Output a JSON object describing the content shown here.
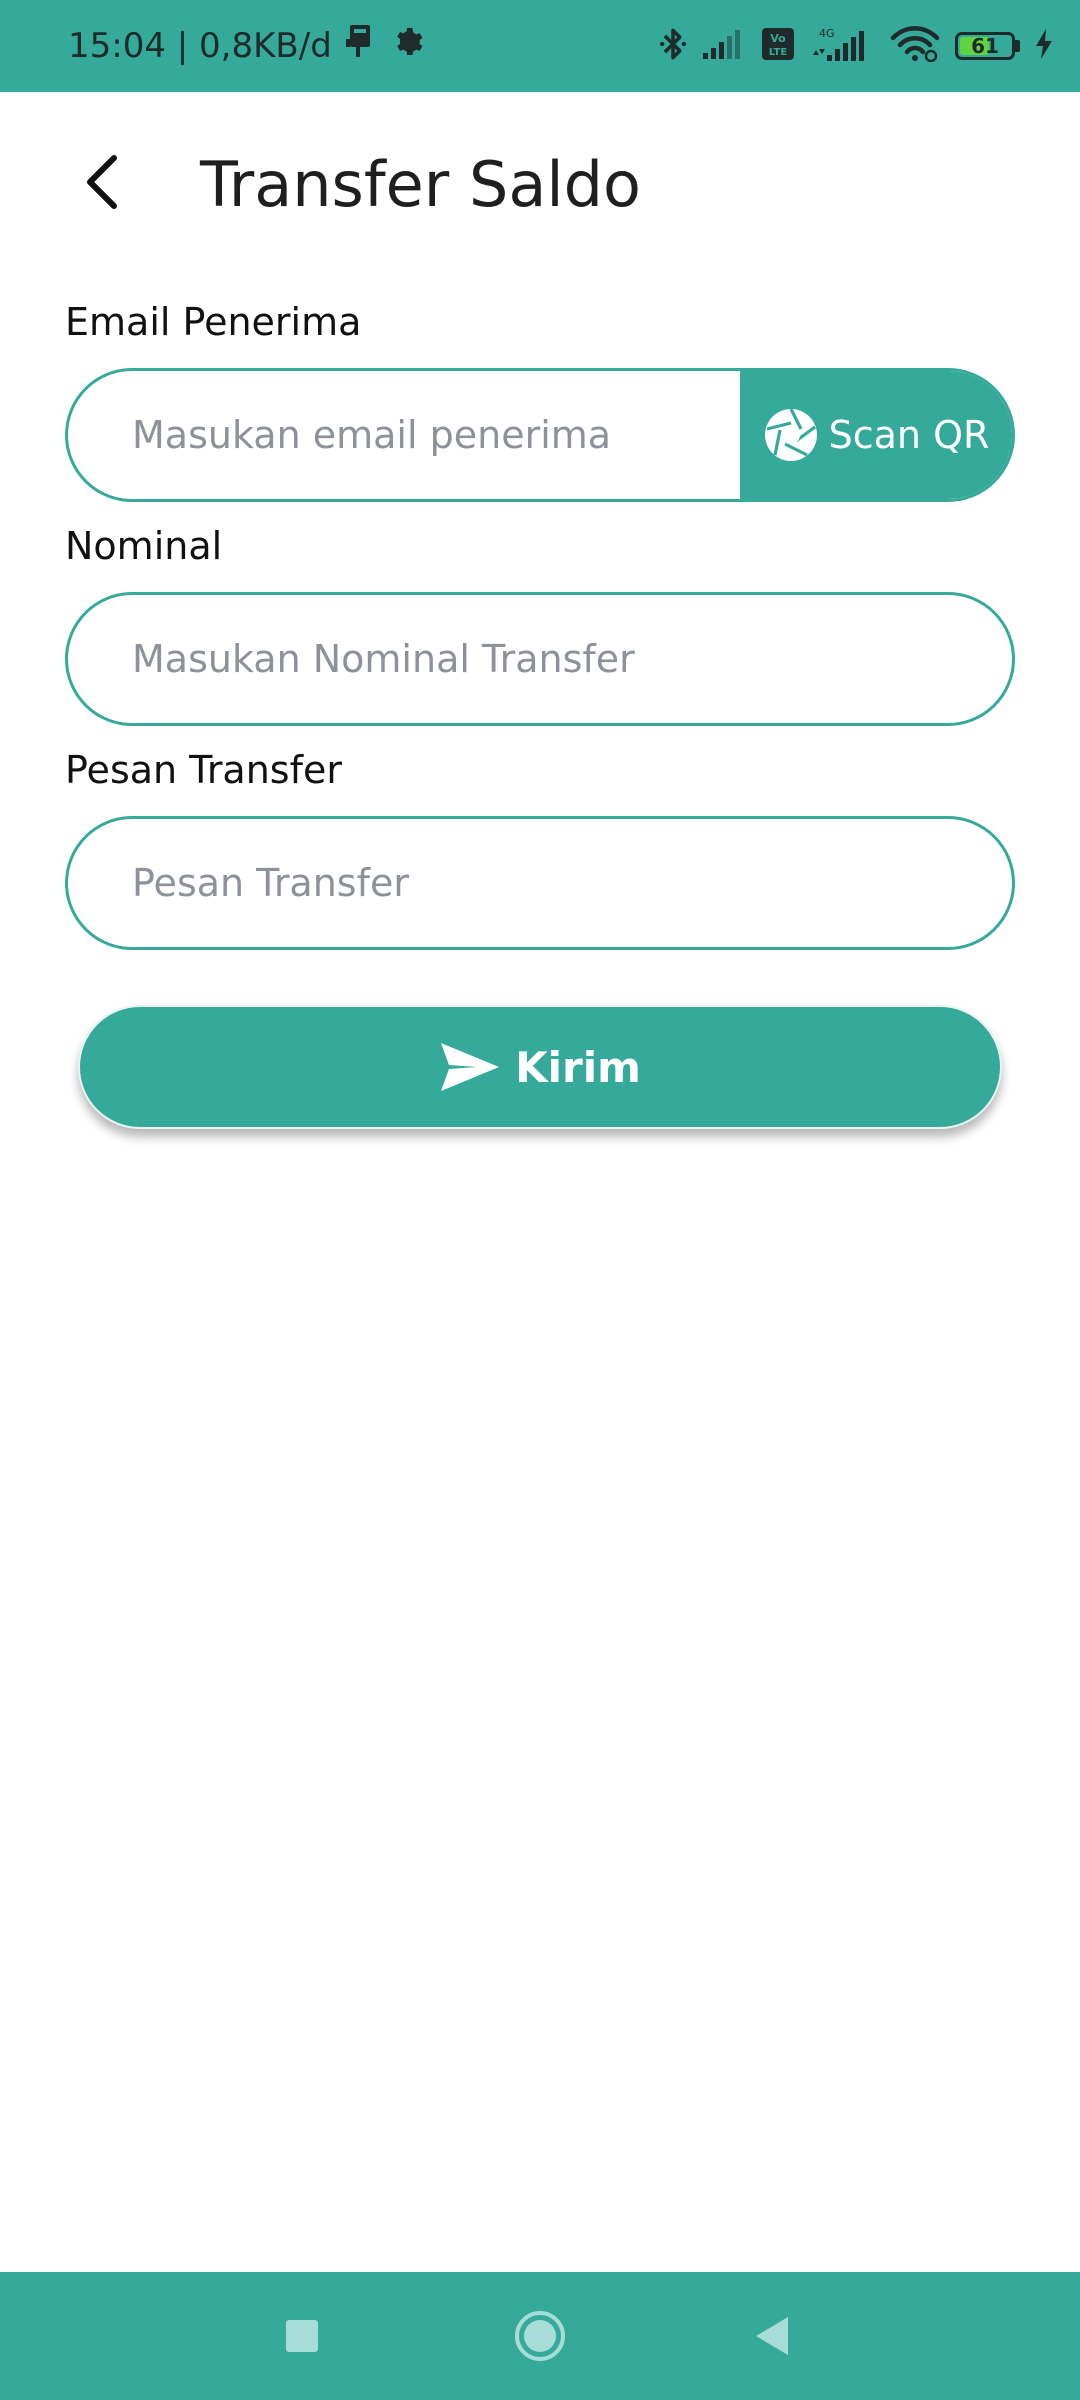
{
  "status_bar": {
    "time_info": "15:04 | 0,8KB/d",
    "battery_level": "61",
    "battery_fraction": 0.61,
    "icons": [
      "usb-debug-icon",
      "settings-icon",
      "bluetooth-icon",
      "signal-icon",
      "volte-icon",
      "4g-signal-icon",
      "wifi-icon",
      "battery-icon",
      "charging-icon"
    ],
    "network_badge_top": "4G",
    "volte_badge": "Vo LTE"
  },
  "header": {
    "title": "Transfer Saldo",
    "back_icon": "back-arrow-icon"
  },
  "form": {
    "email": {
      "label": "Email Penerima",
      "placeholder": "Masukan email penerima",
      "value": ""
    },
    "scan_qr": {
      "label": "Scan QR",
      "icon": "camera-aperture-icon"
    },
    "nominal": {
      "label": "Nominal",
      "placeholder": "Masukan Nominal Transfer",
      "value": ""
    },
    "message": {
      "label": "Pesan Transfer",
      "placeholder": "Pesan Transfer",
      "value": ""
    },
    "submit": {
      "label": "Kirim",
      "icon": "send-icon"
    }
  },
  "nav_bar": {
    "buttons": [
      "recents-button",
      "home-button",
      "back-button"
    ]
  },
  "colors": {
    "accent": "#35aa9b",
    "placeholder": "#8d919a",
    "text": "#111111",
    "battery_fill": "#5fd43c"
  }
}
